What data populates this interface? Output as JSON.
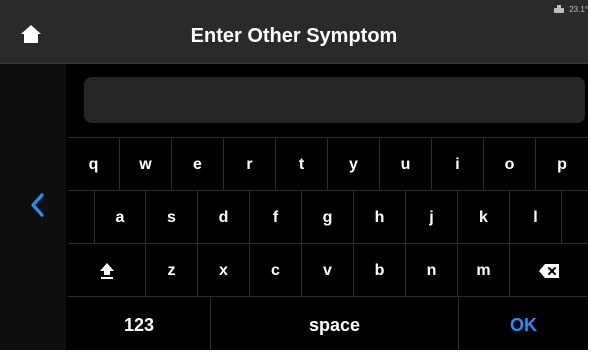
{
  "header": {
    "title": "Enter Other Symptom",
    "status_text": "23.1°"
  },
  "input": {
    "value": "",
    "placeholder": ""
  },
  "keyboard": {
    "row1": [
      "q",
      "w",
      "e",
      "r",
      "t",
      "y",
      "u",
      "i",
      "o",
      "p"
    ],
    "row2": [
      "a",
      "s",
      "d",
      "f",
      "g",
      "h",
      "j",
      "k",
      "l"
    ],
    "row3": [
      "z",
      "x",
      "c",
      "v",
      "b",
      "n",
      "m"
    ],
    "numbers_label": "123",
    "space_label": "space",
    "ok_label": "OK"
  },
  "icons": {
    "home": "home-icon",
    "back": "chevron-left-icon",
    "shift": "shift-icon",
    "backspace": "backspace-icon",
    "status": "pump-icon"
  },
  "colors": {
    "accent": "#1e90ff",
    "background": "#000000",
    "header": "#2a2a2a"
  }
}
